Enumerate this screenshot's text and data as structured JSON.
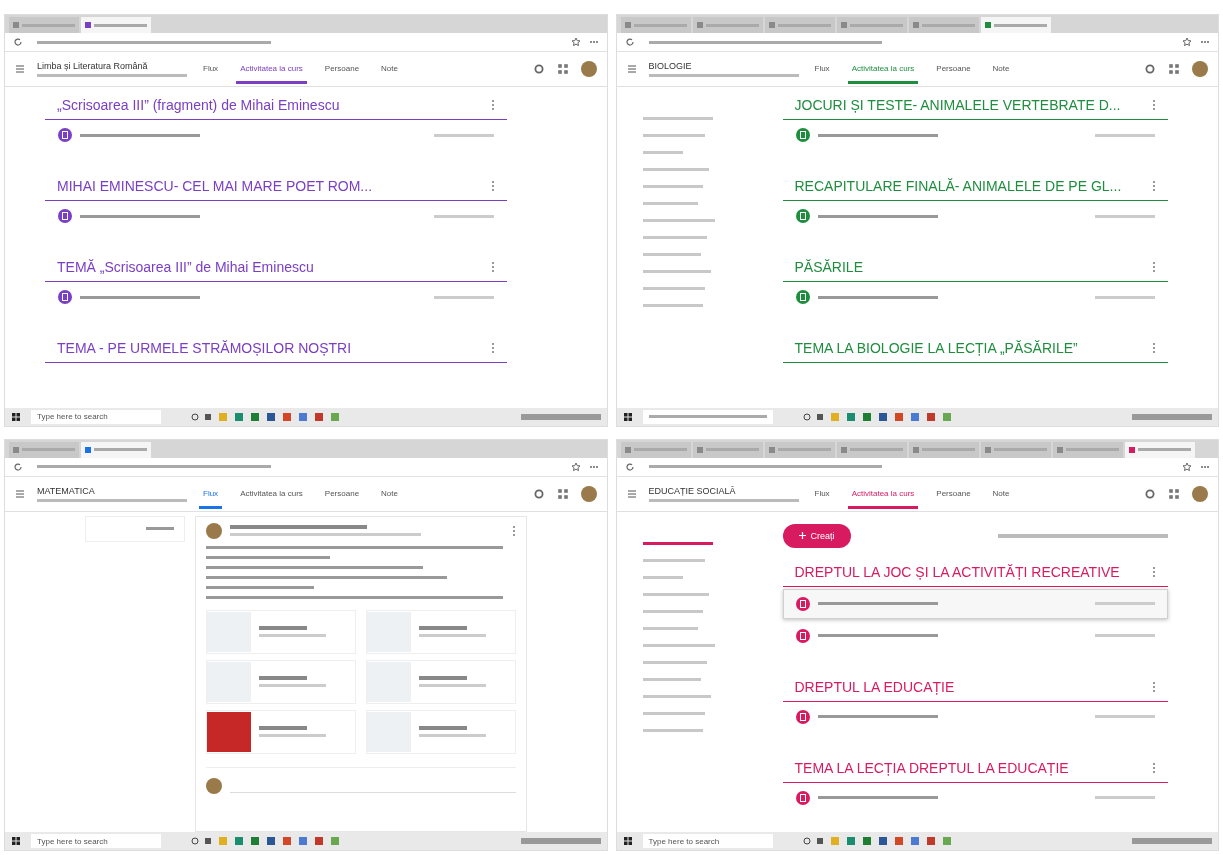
{
  "panels": [
    {
      "kind": "classwork",
      "color": "#7b3fc4",
      "browser_tabs": [
        {
          "selected": false
        },
        {
          "selected": true
        }
      ],
      "course": {
        "name": "Limba și Literatura Română"
      },
      "nav_tabs": [
        {
          "label": "Flux",
          "selected": false
        },
        {
          "label": "Activitatea la curs",
          "selected": true
        },
        {
          "label": "Persoane",
          "selected": false
        },
        {
          "label": "Note",
          "selected": false
        }
      ],
      "topics": [
        {
          "title": "„Scrisoarea III” (fragment) de Mihai Eminescu",
          "materials": [
            {
              "selected": false
            }
          ]
        },
        {
          "title": "MIHAI EMINESCU- CEL MAI MARE POET ROM...",
          "materials": [
            {
              "selected": false
            }
          ]
        },
        {
          "title": "TEMĂ „Scrisoarea III” de Mihai Eminescu",
          "materials": [
            {
              "selected": false
            }
          ]
        },
        {
          "title": "TEMA - PE URMELE STRĂMOȘILOR NOȘTRI"
        }
      ],
      "search": "Type here to search"
    },
    {
      "kind": "classwork",
      "color": "#1e8e3e",
      "browser_tabs": [
        {
          "selected": false
        },
        {
          "selected": false
        },
        {
          "selected": false
        },
        {
          "selected": false
        },
        {
          "selected": false
        },
        {
          "selected": true
        }
      ],
      "course": {
        "name": "BIOLOGIE"
      },
      "nav_tabs": [
        {
          "label": "Flux",
          "selected": false
        },
        {
          "label": "Activitatea la curs",
          "selected": true
        },
        {
          "label": "Persoane",
          "selected": false
        },
        {
          "label": "Note",
          "selected": false
        }
      ],
      "sidebar_items": [
        {
          "selected": false
        },
        {
          "selected": false
        },
        {
          "selected": false
        },
        {
          "selected": false
        },
        {
          "selected": false
        },
        {
          "selected": false
        },
        {
          "selected": false
        },
        {
          "selected": false
        },
        {
          "selected": false
        },
        {
          "selected": false
        },
        {
          "selected": false
        },
        {
          "selected": false
        }
      ],
      "topics": [
        {
          "title": "JOCURI ȘI TESTE- ANIMALELE VERTEBRATE D...",
          "materials": [
            {
              "selected": false
            }
          ]
        },
        {
          "title": "RECAPITULARE FINALĂ- ANIMALELE DE PE GL...",
          "materials": [
            {
              "selected": false
            }
          ]
        },
        {
          "title": "PĂSĂRILE",
          "materials": [
            {
              "selected": false
            }
          ]
        },
        {
          "title": "TEMA LA BIOLOGIE LA LECȚIA „PĂSĂRILE”"
        }
      ]
    },
    {
      "kind": "stream",
      "color": "#1a73e8",
      "browser_tabs": [
        {
          "selected": false
        },
        {
          "selected": true
        }
      ],
      "course": {
        "name": "MATEMATICA"
      },
      "nav_tabs": [
        {
          "label": "Flux",
          "selected": true
        },
        {
          "label": "Activitatea la curs",
          "selected": false
        },
        {
          "label": "Persoane",
          "selected": false
        },
        {
          "label": "Note",
          "selected": false
        }
      ],
      "search": "Type here to search"
    },
    {
      "kind": "classwork",
      "color": "#d81b60",
      "browser_tabs": [
        {
          "selected": false
        },
        {
          "selected": false
        },
        {
          "selected": false
        },
        {
          "selected": false
        },
        {
          "selected": false
        },
        {
          "selected": false
        },
        {
          "selected": false
        },
        {
          "selected": true
        }
      ],
      "course": {
        "name": "EDUCAȚIE SOCIALĂ"
      },
      "nav_tabs": [
        {
          "label": "Flux",
          "selected": false
        },
        {
          "label": "Activitatea la curs",
          "selected": true
        },
        {
          "label": "Persoane",
          "selected": false
        },
        {
          "label": "Note",
          "selected": false
        }
      ],
      "create_button": "Creați",
      "sidebar_items": [
        {
          "selected": true
        },
        {
          "selected": false
        },
        {
          "selected": false
        },
        {
          "selected": false
        },
        {
          "selected": false
        },
        {
          "selected": false
        },
        {
          "selected": false
        },
        {
          "selected": false
        },
        {
          "selected": false
        },
        {
          "selected": false
        },
        {
          "selected": false
        },
        {
          "selected": false
        }
      ],
      "topics": [
        {
          "title": "DREPTUL LA JOC ȘI LA ACTIVITĂȚI RECREATIVE",
          "materials": [
            {
              "selected": true
            },
            {
              "selected": false
            }
          ]
        },
        {
          "title": "DREPTUL LA EDUCAȚIE",
          "materials": [
            {
              "selected": false
            }
          ]
        },
        {
          "title": "TEMA LA LECȚIA DREPTUL LA EDUCAȚIE",
          "materials": [
            {
              "selected": false
            }
          ]
        }
      ],
      "search": "Type here to search"
    }
  ]
}
